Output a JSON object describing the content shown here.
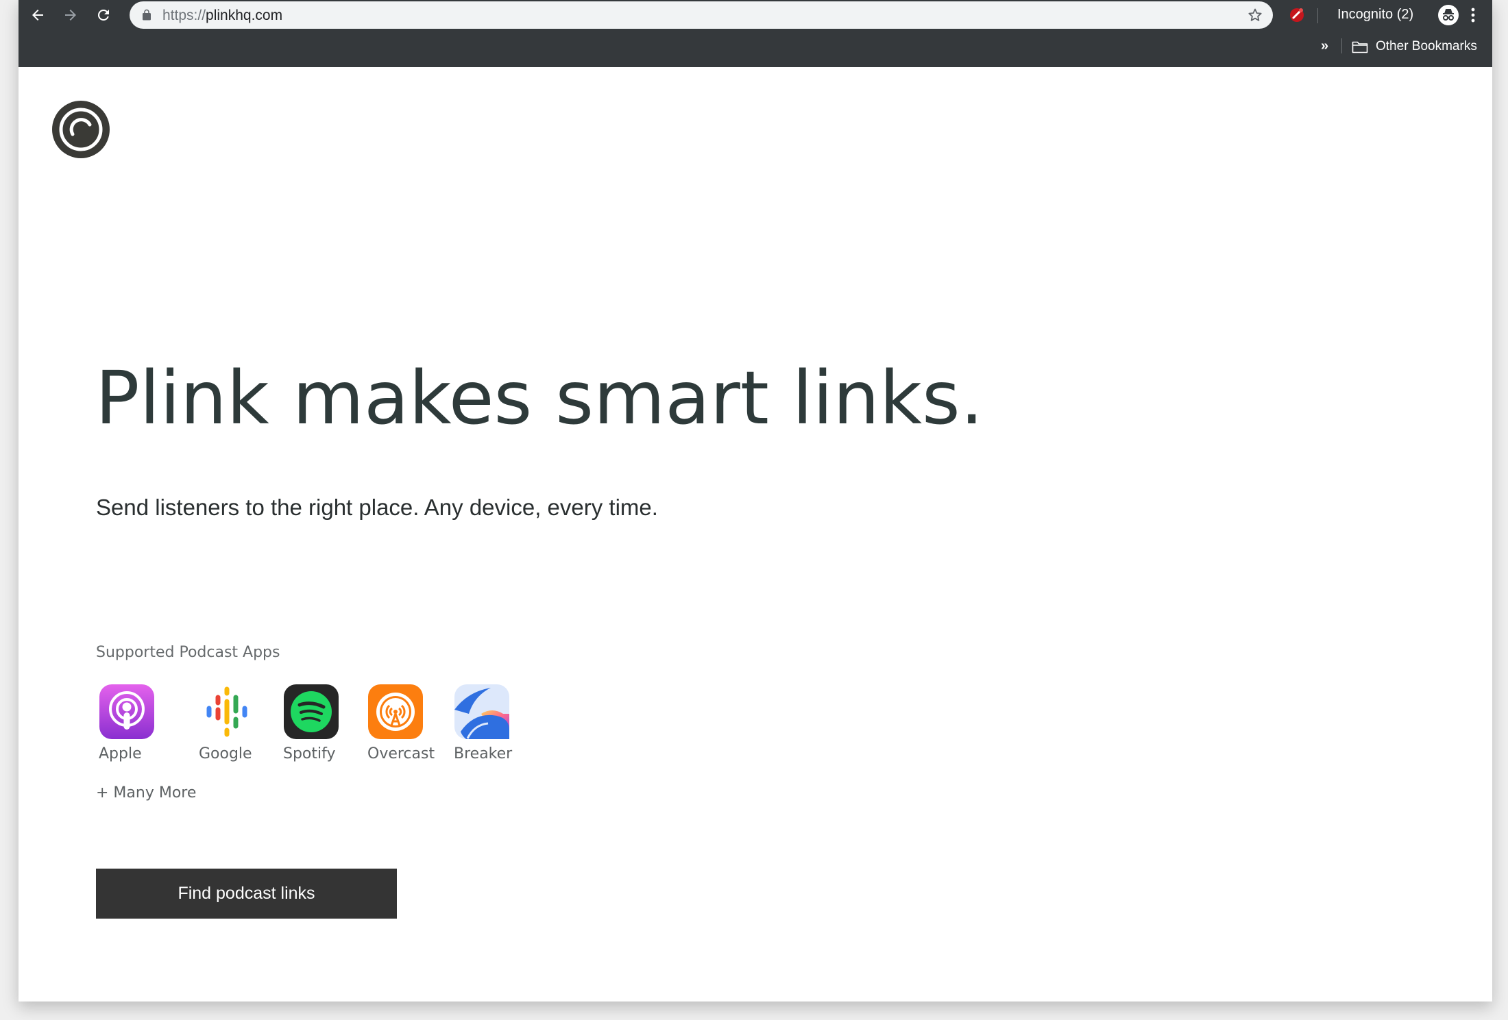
{
  "browser": {
    "url_scheme": "https://",
    "url_host": "plinkhq.com",
    "incognito_label": "Incognito (2)",
    "bookmarks_chevron": "»",
    "bookmarks_folder_label": "Other Bookmarks",
    "icons": [
      "back-icon",
      "forward-icon",
      "reload-icon",
      "lock-icon",
      "star-icon",
      "extension-icon",
      "incognito-icon",
      "menu-icon",
      "folder-icon"
    ]
  },
  "hero": {
    "headline": "Plink makes smart links.",
    "tagline": "Send listeners to the right place. Any device, every time."
  },
  "apps": {
    "heading": "Supported Podcast Apps",
    "items": [
      {
        "label": "Apple",
        "icon": "apple-podcasts-icon",
        "color": "#a63dd6"
      },
      {
        "label": "Google",
        "icon": "google-podcasts-icon",
        "color": "#ffffff"
      },
      {
        "label": "Spotify",
        "icon": "spotify-icon",
        "color": "#1ed760"
      },
      {
        "label": "Overcast",
        "icon": "overcast-icon",
        "color": "#fc7e0f"
      },
      {
        "label": "Breaker",
        "icon": "breaker-icon",
        "color": "#2f6fe0"
      }
    ],
    "more": "+ Many More"
  },
  "cta": {
    "label": "Find podcast links"
  },
  "colors": {
    "chrome_bg": "#35393c",
    "headline": "#2e3a3a",
    "button_bg": "#343434",
    "logo": "#3a3a36"
  }
}
